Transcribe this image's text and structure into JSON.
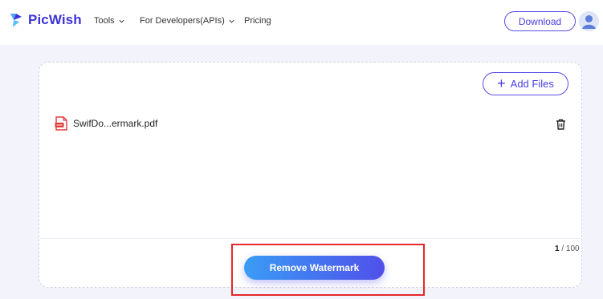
{
  "header": {
    "logo_text": "PicWish",
    "nav": [
      {
        "label": "Tools"
      },
      {
        "label": "For Developers(APIs)"
      },
      {
        "label": "Pricing"
      }
    ],
    "download_label": "Download"
  },
  "panel": {
    "add_files_label": "Add Files",
    "files": [
      {
        "name": "SwifDo...ermark.pdf"
      }
    ],
    "counter": {
      "current": "1",
      "separator": " / ",
      "max": "100"
    },
    "remove_label": "Remove Watermark"
  },
  "colors": {
    "brand": "#3d33d6",
    "accent_border": "#5a4ee6",
    "button_gradient_start": "#3a9cf5",
    "button_gradient_end": "#5050ea",
    "highlight": "#e4282b",
    "pdf_red": "#e23b3b"
  },
  "icons": [
    "picwish-logo-icon",
    "chevron-down-icon",
    "avatar-icon",
    "plus-icon",
    "pdf-file-icon",
    "trash-icon"
  ]
}
